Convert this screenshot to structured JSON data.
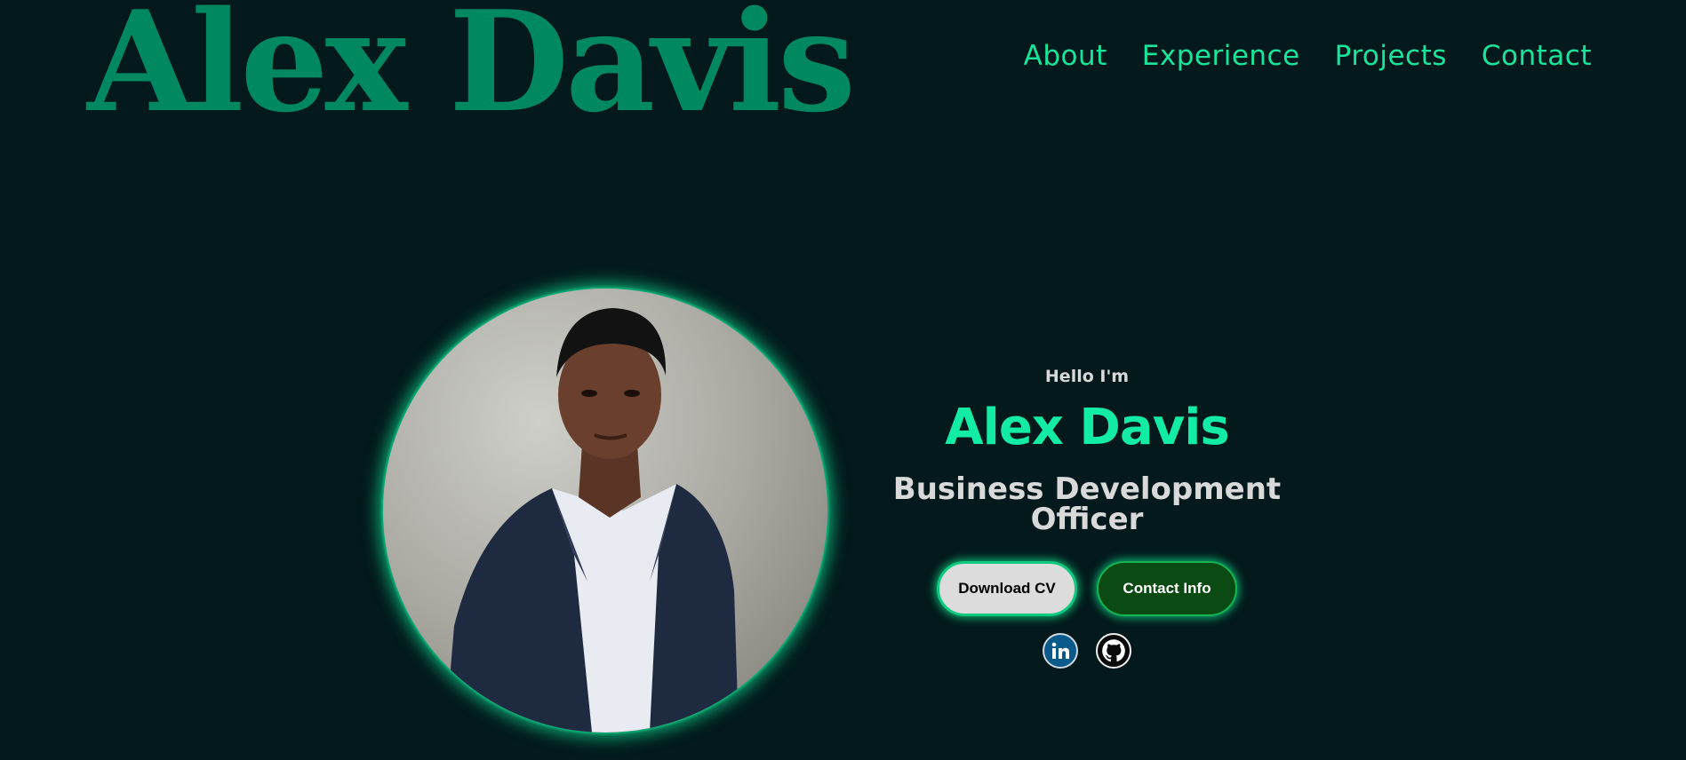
{
  "header": {
    "logo_text": "Alex Davis",
    "nav": [
      {
        "label": "About"
      },
      {
        "label": "Experience"
      },
      {
        "label": "Projects"
      },
      {
        "label": "Contact"
      }
    ]
  },
  "hero": {
    "greeting": "Hello I'm",
    "name": "Alex Davis",
    "role": "Business Development Officer",
    "buttons": {
      "download_cv": "Download CV",
      "contact_info": "Contact Info"
    },
    "socials": [
      {
        "icon": "linkedin-icon"
      },
      {
        "icon": "github-icon"
      }
    ],
    "photo": {
      "icon": "profile-photo"
    }
  },
  "colors": {
    "background": "#03191b",
    "logo": "#008960",
    "accent": "#13eca4",
    "nav": "#18e59c",
    "text_light": "#d9d9d9",
    "contact_button": "#0b4a12",
    "linkedin": "#0a5a8c"
  }
}
